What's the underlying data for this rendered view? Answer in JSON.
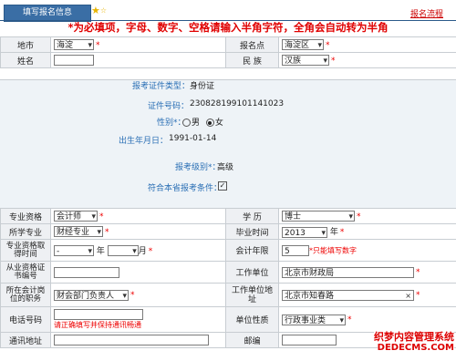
{
  "header": {
    "tab_label": "填写报名信息",
    "process_link": "报名流程",
    "notice": "*为必填项，字母、数字、空格请输入半角字符，全角会自动转为半角"
  },
  "row_area": {
    "label": "地市",
    "value": "海淀",
    "point_label": "报名点",
    "point_value": "海淀区"
  },
  "row_name": {
    "label": "姓名",
    "value": "",
    "ethnic_label": "民  族",
    "ethnic_value": "汉族"
  },
  "identity": {
    "doc_type_label": "报考证件类型：",
    "doc_type_value": "身份证",
    "doc_no_label": "证件号码：",
    "doc_no_value": "230828199101141023",
    "gender_label": "性别*：",
    "gender_male": "男",
    "gender_female": "女",
    "gender_selected": "女",
    "birth_label": "出生年月日：",
    "birth_value": "1991-01-14",
    "level_label": "报考级别*：",
    "level_value": "高级",
    "meet_label": "符合本省报考条件：",
    "meet_checked": true
  },
  "form": {
    "qual_label": "专业资格",
    "qual_value": "会计师",
    "edu_label": "学  历",
    "edu_value": "博士",
    "major_label": "所学专业",
    "major_value": "财经专业",
    "grad_label": "毕业时间",
    "grad_value": "2013",
    "grad_unit": "年",
    "qual_time_label": "专业资格取得时间",
    "qual_year_value": "-",
    "qual_year_unit": "年",
    "qual_month_value": "",
    "qual_month_unit": "月",
    "years_label": "会计年限",
    "years_value": "5",
    "years_hint": "*只能填写数字",
    "cert_label": "从业资格证书编号",
    "cert_value": "",
    "work_label": "工作单位",
    "work_value": "北京市财政局",
    "position_label": "所在会计岗位的职务",
    "position_value": "财会部门负责人",
    "addr_label": "工作单位地址",
    "addr_value": "北京市知春路",
    "addr_clear": "×",
    "phone_label": "电话号码",
    "phone_value": "",
    "phone_hint": "请正确填写并保持通讯畅通",
    "nature_label": "单位性质",
    "nature_value": "行政事业类",
    "mail_label": "通讯地址",
    "mail_value": "",
    "zip_label": "邮编",
    "zip_value": ""
  },
  "watermark": {
    "line1": "织梦内容管理系统",
    "line2": "DEDECMS.COM"
  },
  "colors": {
    "accent": "#3a6ea5",
    "required": "#e00000",
    "label_blue": "#2a6fb5"
  }
}
